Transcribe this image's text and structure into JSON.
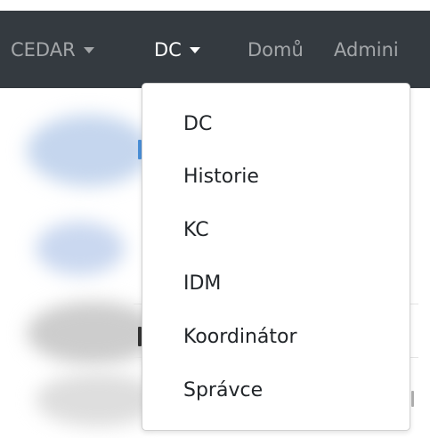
{
  "navbar": {
    "items": [
      {
        "label": "CEDAR",
        "has_caret": true
      },
      {
        "label": "DC",
        "has_caret": true
      },
      {
        "label": "Domů",
        "has_caret": false
      },
      {
        "label": "Admini",
        "has_caret": false
      }
    ],
    "colors": {
      "background": "#343a40",
      "text": "#9a9da0",
      "active_text": "#ffffff"
    }
  },
  "dropdown": {
    "items": [
      {
        "label": "DC"
      },
      {
        "label": "Historie"
      },
      {
        "label": "KC"
      },
      {
        "label": "IDM"
      },
      {
        "label": "Koordinátor"
      },
      {
        "label": "Správce"
      }
    ]
  }
}
